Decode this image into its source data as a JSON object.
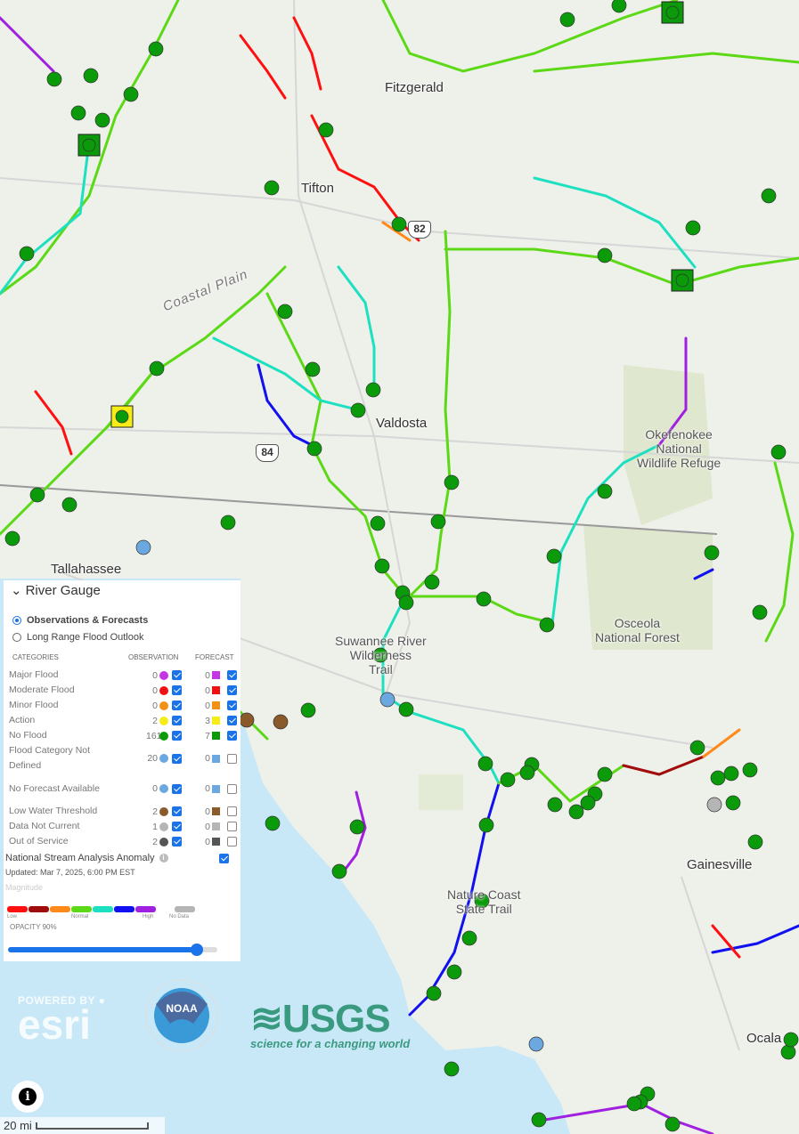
{
  "places": {
    "fitzgerald": "Fitzgerald",
    "tifton": "Tifton",
    "valdosta": "Valdosta",
    "tallahassee": "Tallahassee",
    "gainesville": "Gainesville",
    "ocala": "Ocala",
    "coastal_plain": "Coastal Plain",
    "okefenokee": "Okefenokee\nNational\nWildlife Refuge",
    "osceola": "Osceola\nNational Forest",
    "suwannee": "Suwannee River\nWilderness\nTrail",
    "nature_coast": "Nature Coast\nState Trail"
  },
  "highways": {
    "us82": "82",
    "us84": "84"
  },
  "panel": {
    "title": "River Gauge",
    "radio_options": [
      {
        "label": "Observations & Forecasts",
        "selected": true
      },
      {
        "label": "Long Range Flood Outlook",
        "selected": false
      }
    ],
    "headers": {
      "categories": "CATEGORIES",
      "observation": "OBSERVATION",
      "forecast": "FORECAST"
    },
    "rows": [
      {
        "label": "Major Flood",
        "obs": "0",
        "obs_color": "#c535e6",
        "obs_checked": true,
        "fc": "0",
        "fc_color": "#c535e6",
        "fc_checked": true
      },
      {
        "label": "Moderate Flood",
        "obs": "0",
        "obs_color": "#ee1111",
        "obs_checked": true,
        "fc": "0",
        "fc_color": "#ee1111",
        "fc_checked": true
      },
      {
        "label": "Minor Flood",
        "obs": "0",
        "obs_color": "#f39016",
        "obs_checked": true,
        "fc": "0",
        "fc_color": "#f39016",
        "fc_checked": true
      },
      {
        "label": "Action",
        "obs": "2",
        "obs_color": "#f5ec18",
        "obs_checked": true,
        "fc": "3",
        "fc_color": "#f5ec18",
        "fc_checked": true
      },
      {
        "label": "No Flood",
        "obs": "161",
        "obs_color": "#0a9a0a",
        "obs_checked": true,
        "fc": "7",
        "fc_color": "#0a9a0a",
        "fc_checked": true
      },
      {
        "label": "Flood Category Not Defined",
        "obs": "20",
        "obs_color": "#6ba8e0",
        "obs_checked": true,
        "fc": "0",
        "fc_color": "#6ba8e0",
        "fc_checked": false
      },
      {
        "label": "No Forecast Available",
        "obs": "0",
        "obs_color": "#6ba8e0",
        "obs_checked": true,
        "fc": "0",
        "fc_color": "#6ba8e0",
        "fc_checked": false
      },
      {
        "label": "Low Water Threshold",
        "obs": "2",
        "obs_color": "#8b5a2b",
        "obs_checked": true,
        "fc": "0",
        "fc_color": "#8b5a2b",
        "fc_checked": false
      },
      {
        "label": "Data Not Current",
        "obs": "1",
        "obs_color": "#b5b5b5",
        "obs_checked": true,
        "fc": "0",
        "fc_color": "#b5b5b5",
        "fc_checked": false
      },
      {
        "label": "Out of Service",
        "obs": "2",
        "obs_color": "#555555",
        "obs_checked": true,
        "fc": "0",
        "fc_color": "#555555",
        "fc_checked": false
      }
    ],
    "nsa_label": "National Stream Analysis Anomaly",
    "nsa_checked": true,
    "updated": "Updated: Mar 7, 2025, 6:00 PM EST",
    "magnitude": "Magnitude",
    "ramp_colors": [
      "#ff1010",
      "#a00c0c",
      "#ff8a1a",
      "#5cd916",
      "#1de0c0",
      "#1010f0",
      "#a020e0"
    ],
    "nodata_color": "#b5b5b5",
    "ramp_labels": {
      "low": "Low",
      "normal": "Normal",
      "high": "High",
      "nodata": "No Data"
    },
    "opacity_label": "OPACITY 90%",
    "opacity": 90
  },
  "logos": {
    "esri_top": "POWERED BY",
    "esri": "esri",
    "noaa": "NOAA",
    "usgs": "USGS",
    "usgs_tag": "science for a changing world"
  },
  "scale": "20 mi"
}
